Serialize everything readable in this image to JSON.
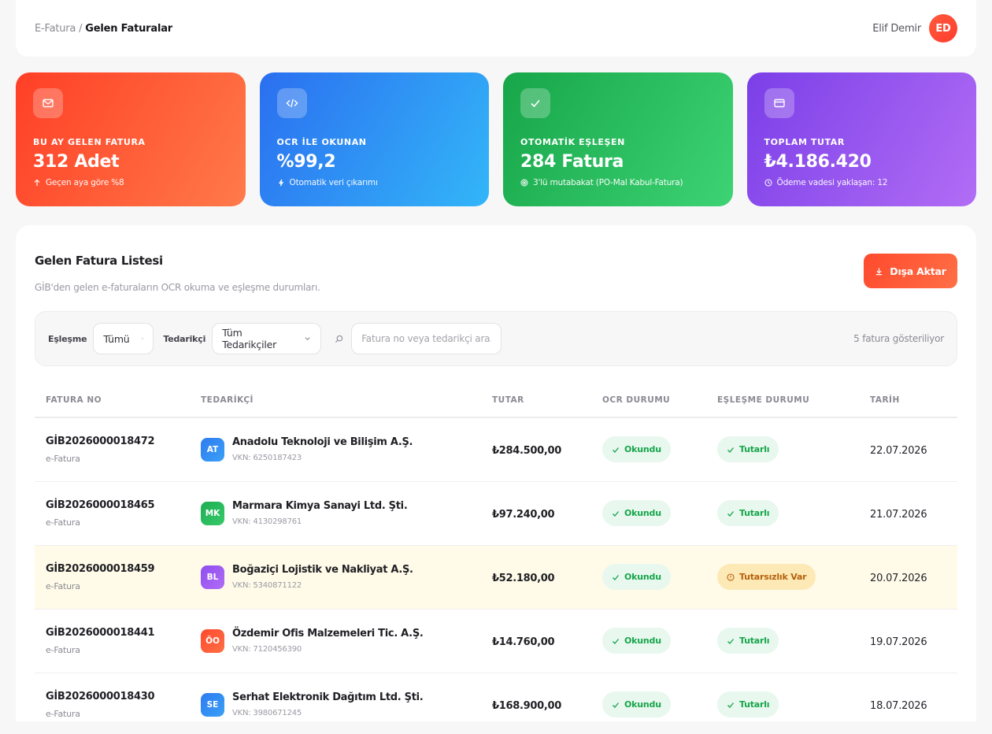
{
  "header": {
    "breadcrumb_root": "E-Fatura",
    "breadcrumb_separator": "/",
    "breadcrumb_current": "Gelen Faturalar",
    "user_name": "Elif Demir",
    "user_initials": "ED"
  },
  "stats": [
    {
      "label": "BU AY GELEN FATURA",
      "value": "312 Adet",
      "sub": "Geçen aya göre %8",
      "icon": "mail-icon",
      "sub_icon": "arrow-up-icon"
    },
    {
      "label": "OCR İLE OKUNAN",
      "value": "%99,2",
      "sub": "Otomatik veri çıkarımı",
      "icon": "code-icon",
      "sub_icon": "bolt-icon"
    },
    {
      "label": "OTOMATİK EŞLEŞEN",
      "value": "284 Fatura",
      "sub": "3'lü mutabakat (PO-Mal Kabul-Fatura)",
      "icon": "check-icon",
      "sub_icon": "target-icon"
    },
    {
      "label": "TOPLAM TUTAR",
      "value": "₺4.186.420",
      "sub": "Ödeme vadesi yaklaşan: 12",
      "icon": "card-icon",
      "sub_icon": "clock-icon"
    }
  ],
  "panel": {
    "title": "Gelen Fatura Listesi",
    "subtitle": "GİB'den gelen e-faturaların OCR okuma ve eşleşme durumları.",
    "export_label": "Dışa Aktar"
  },
  "filters": {
    "match_label": "Eşleşme",
    "match_value": "Tümü",
    "supplier_label": "Tedarikçi",
    "supplier_value": "Tüm Tedarikçiler",
    "search_placeholder": "Fatura no veya tedarikçi ara...",
    "count_text": "5 fatura gösteriliyor"
  },
  "table": {
    "headers": [
      "FATURA NO",
      "TEDARİKÇİ",
      "TUTAR",
      "OCR DURUMU",
      "EŞLEŞME DURUMU",
      "TARİH"
    ],
    "rows": [
      {
        "no": "GİB2026000018472",
        "type": "e-Fatura",
        "initials": "AT",
        "supplier": "Anadolu Teknoloji ve Bilişim A.Ş.",
        "vkn": "VKN: 6250187423",
        "amount": "₺284.500,00",
        "ocr": "Okundu",
        "match": "Tutarlı",
        "date": "22.07.2026",
        "avatar_color": "#2f7bf0"
      },
      {
        "no": "GİB2026000018465",
        "type": "e-Fatura",
        "initials": "MK",
        "supplier": "Marmara Kimya Sanayi Ltd. Şti.",
        "vkn": "VKN: 4130298761",
        "amount": "₺97.240,00",
        "ocr": "Okundu",
        "match": "Tutarlı",
        "date": "21.07.2026",
        "avatar_color": "#1fae52"
      },
      {
        "no": "GİB2026000018459",
        "type": "e-Fatura",
        "initials": "BL",
        "supplier": "Boğaziçi Lojistik ve Nakliyat A.Ş.",
        "vkn": "VKN: 5340871122",
        "amount": "₺52.180,00",
        "ocr": "Okundu",
        "match": "Tutarsızlık Var",
        "date": "20.07.2026",
        "avatar_color": "#8f4ef0"
      },
      {
        "no": "GİB2026000018441",
        "type": "e-Fatura",
        "initials": "ÖO",
        "supplier": "Özdemir Ofis Malzemeleri Tic. A.Ş.",
        "vkn": "VKN: 7120456390",
        "amount": "₺14.760,00",
        "ocr": "Okundu",
        "match": "Tutarlı",
        "date": "19.07.2026",
        "avatar_color": "#ff4a2e"
      },
      {
        "no": "GİB2026000018430",
        "type": "e-Fatura",
        "initials": "SE",
        "supplier": "Serhat Elektronik Dağıtım Ltd. Şti.",
        "vkn": "VKN: 3980671245",
        "amount": "₺168.900,00",
        "ocr": "Okundu",
        "match": "Tutarlı",
        "date": "18.07.2026",
        "avatar_color": "#2f7bf0"
      }
    ]
  },
  "colors": {
    "accent": "#ff4a2e",
    "ok": "#17a54b",
    "warn": "#b5620c",
    "warn_row": "#fffbe8"
  }
}
